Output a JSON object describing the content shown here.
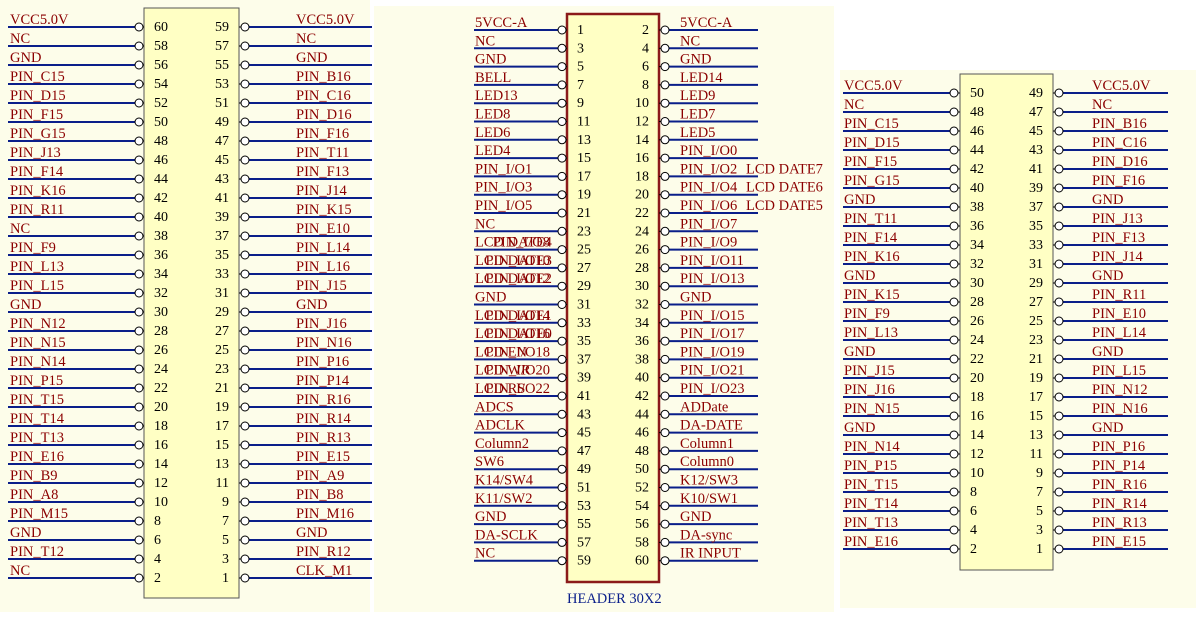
{
  "colors": {
    "panel": "#fdfdea",
    "body_fill": "#ffffc4",
    "body_border": "#555555",
    "wire": "#0a1e8a",
    "net_text": "#8b0000",
    "pin_text": "#000000",
    "ref_text": "#0a1e8a",
    "header_border": "#8b1a1a"
  },
  "connectors": [
    {
      "id": "left",
      "pin_pairs": [
        {
          "l": 60,
          "r": 59,
          "ln": "VCC5.0V",
          "rn": "VCC5.0V"
        },
        {
          "l": 58,
          "r": 57,
          "ln": "NC",
          "rn": "NC"
        },
        {
          "l": 56,
          "r": 55,
          "ln": "GND",
          "rn": "GND"
        },
        {
          "l": 54,
          "r": 53,
          "ln": "PIN_C15",
          "rn": "PIN_B16"
        },
        {
          "l": 52,
          "r": 51,
          "ln": "PIN_D15",
          "rn": "PIN_C16"
        },
        {
          "l": 50,
          "r": 49,
          "ln": "PIN_F15",
          "rn": "PIN_D16"
        },
        {
          "l": 48,
          "r": 47,
          "ln": "PIN_G15",
          "rn": "PIN_F16"
        },
        {
          "l": 46,
          "r": 45,
          "ln": "PIN_J13",
          "rn": "PIN_T11"
        },
        {
          "l": 44,
          "r": 43,
          "ln": "PIN_F14",
          "rn": "PIN_F13"
        },
        {
          "l": 42,
          "r": 41,
          "ln": "PIN_K16",
          "rn": "PIN_J14"
        },
        {
          "l": 40,
          "r": 39,
          "ln": "PIN_R11",
          "rn": "PIN_K15"
        },
        {
          "l": 38,
          "r": 37,
          "ln": "NC",
          "rn": "PIN_E10"
        },
        {
          "l": 36,
          "r": 35,
          "ln": "PIN_F9",
          "rn": "PIN_L14"
        },
        {
          "l": 34,
          "r": 33,
          "ln": "PIN_L13",
          "rn": "PIN_L16"
        },
        {
          "l": 32,
          "r": 31,
          "ln": "PIN_L15",
          "rn": "PIN_J15"
        },
        {
          "l": 30,
          "r": 29,
          "ln": "GND",
          "rn": "GND"
        },
        {
          "l": 28,
          "r": 27,
          "ln": "PIN_N12",
          "rn": "PIN_J16"
        },
        {
          "l": 26,
          "r": 25,
          "ln": "PIN_N15",
          "rn": "PIN_N16"
        },
        {
          "l": 24,
          "r": 23,
          "ln": "PIN_N14",
          "rn": "PIN_P16"
        },
        {
          "l": 22,
          "r": 21,
          "ln": "PIN_P15",
          "rn": "PIN_P14"
        },
        {
          "l": 20,
          "r": 19,
          "ln": "PIN_T15",
          "rn": "PIN_R16"
        },
        {
          "l": 18,
          "r": 17,
          "ln": "PIN_T14",
          "rn": "PIN_R14"
        },
        {
          "l": 16,
          "r": 15,
          "ln": "PIN_T13",
          "rn": "PIN_R13"
        },
        {
          "l": 14,
          "r": 13,
          "ln": "PIN_E16",
          "rn": "PIN_E15"
        },
        {
          "l": 12,
          "r": 11,
          "ln": "PIN_B9",
          "rn": "PIN_A9"
        },
        {
          "l": 10,
          "r": 9,
          "ln": "PIN_A8",
          "rn": "PIN_B8"
        },
        {
          "l": 8,
          "r": 7,
          "ln": "PIN_M15",
          "rn": "PIN_M16"
        },
        {
          "l": 6,
          "r": 5,
          "ln": "GND",
          "rn": "GND"
        },
        {
          "l": 4,
          "r": 3,
          "ln": "PIN_T12",
          "rn": "PIN_R12"
        },
        {
          "l": 2,
          "r": 1,
          "ln": "NC",
          "rn": "CLK_M1"
        }
      ]
    },
    {
      "id": "middle",
      "ref_label": "HEADER 30X2",
      "pin_pairs": [
        {
          "l": 1,
          "r": 2,
          "ln": "5VCC-A",
          "rn": "5VCC-A"
        },
        {
          "l": 3,
          "r": 4,
          "ln": "NC",
          "rn": "NC"
        },
        {
          "l": 5,
          "r": 6,
          "ln": "GND",
          "rn": "GND"
        },
        {
          "l": 7,
          "r": 8,
          "ln": "BELL",
          "rn": "LED14"
        },
        {
          "l": 9,
          "r": 10,
          "ln": "LED13",
          "rn": "LED9"
        },
        {
          "l": 11,
          "r": 12,
          "ln": "LED8",
          "rn": "LED7"
        },
        {
          "l": 13,
          "r": 14,
          "ln": "LED6",
          "rn": "LED5"
        },
        {
          "l": 15,
          "r": 16,
          "ln": "LED4",
          "rn": "PIN_I/O0"
        },
        {
          "l": 17,
          "r": 18,
          "ln": "PIN_I/O1",
          "rn": "PIN_I/O2",
          "rx": "LCD DATE7"
        },
        {
          "l": 19,
          "r": 20,
          "ln": "PIN_I/O3",
          "rn": "PIN_I/O4",
          "rx": "LCD DATE6"
        },
        {
          "l": 21,
          "r": 22,
          "ln": "PIN_I/O5",
          "rn": "PIN_I/O6",
          "rx": "LCD DATE5"
        },
        {
          "l": 23,
          "r": 24,
          "ln": "NC",
          "rn": "PIN_I/O7"
        },
        {
          "l": 25,
          "r": 26,
          "ln": "LCD DATE4",
          "lx": "PIN_I/O8",
          "rn": "PIN_I/O9"
        },
        {
          "l": 27,
          "r": 28,
          "ln": "LCD DATE3",
          "lx": "PIN_I/O10",
          "rn": "PIN_I/O11"
        },
        {
          "l": 29,
          "r": 30,
          "ln": "LCD DATE2",
          "lx": "PIN_I/O12",
          "rn": "PIN_I/O13"
        },
        {
          "l": 31,
          "r": 32,
          "ln": "GND",
          "rn": "GND"
        },
        {
          "l": 33,
          "r": 34,
          "ln": "LCD DATE1",
          "lx": "PIN_I/O14",
          "rn": "PIN_I/O15"
        },
        {
          "l": 35,
          "r": 36,
          "ln": "LCD DATE0",
          "lx": "PIN_I/O16",
          "rn": "PIN_I/O17"
        },
        {
          "l": 37,
          "r": 38,
          "ln": "LCD EN",
          "lx": "PIN_I/O18",
          "rn": "PIN_I/O19"
        },
        {
          "l": 39,
          "r": 40,
          "ln": "LCD WR",
          "lx": "PIN_I/O20",
          "rn": "PIN_I/O21"
        },
        {
          "l": 41,
          "r": 42,
          "ln": "LCD RS",
          "lx": "PIN_I/O22",
          "rn": "PIN_I/O23"
        },
        {
          "l": 43,
          "r": 44,
          "ln": "ADCS",
          "rn": "ADDate"
        },
        {
          "l": 45,
          "r": 46,
          "ln": "ADCLK",
          "rn": "DA-DATE"
        },
        {
          "l": 47,
          "r": 48,
          "ln": "Column2",
          "rn": "Column1"
        },
        {
          "l": 49,
          "r": 50,
          "ln": "SW6",
          "rn": "Column0"
        },
        {
          "l": 51,
          "r": 52,
          "ln": "K14/SW4",
          "rn": "K12/SW3"
        },
        {
          "l": 53,
          "r": 54,
          "ln": "K11/SW2",
          "rn": "K10/SW1"
        },
        {
          "l": 55,
          "r": 56,
          "ln": "GND",
          "rn": "GND"
        },
        {
          "l": 57,
          "r": 58,
          "ln": "DA-SCLK",
          "rn": "DA-sync"
        },
        {
          "l": 59,
          "r": 60,
          "ln": "NC",
          "rn": "IR INPUT"
        }
      ]
    },
    {
      "id": "right",
      "pin_pairs": [
        {
          "l": 50,
          "r": 49,
          "ln": "VCC5.0V",
          "rn": "VCC5.0V"
        },
        {
          "l": 48,
          "r": 47,
          "ln": "NC",
          "rn": "NC"
        },
        {
          "l": 46,
          "r": 45,
          "ln": "PIN_C15",
          "rn": "PIN_B16"
        },
        {
          "l": 44,
          "r": 43,
          "ln": "PIN_D15",
          "rn": "PIN_C16"
        },
        {
          "l": 42,
          "r": 41,
          "ln": "PIN_F15",
          "rn": "PIN_D16"
        },
        {
          "l": 40,
          "r": 39,
          "ln": "PIN_G15",
          "rn": "PIN_F16"
        },
        {
          "l": 38,
          "r": 37,
          "ln": "GND",
          "rn": "GND"
        },
        {
          "l": 36,
          "r": 35,
          "ln": "PIN_T11",
          "rn": "PIN_J13"
        },
        {
          "l": 34,
          "r": 33,
          "ln": "PIN_F14",
          "rn": "PIN_F13"
        },
        {
          "l": 32,
          "r": 31,
          "ln": "PIN_K16",
          "rn": "PIN_J14"
        },
        {
          "l": 30,
          "r": 29,
          "ln": "GND",
          "rn": "GND"
        },
        {
          "l": 28,
          "r": 27,
          "ln": "PIN_K15",
          "rn": "PIN_R11"
        },
        {
          "l": 26,
          "r": 25,
          "ln": "PIN_F9",
          "rn": "PIN_E10"
        },
        {
          "l": 24,
          "r": 23,
          "ln": "PIN_L13",
          "rn": "PIN_L14"
        },
        {
          "l": 22,
          "r": 21,
          "ln": "GND",
          "rn": "GND"
        },
        {
          "l": 20,
          "r": 19,
          "ln": "PIN_J15",
          "rn": "PIN_L15"
        },
        {
          "l": 18,
          "r": 17,
          "ln": "PIN_J16",
          "rn": "PIN_N12"
        },
        {
          "l": 16,
          "r": 15,
          "ln": "PIN_N15",
          "rn": "PIN_N16"
        },
        {
          "l": 14,
          "r": 13,
          "ln": "GND",
          "rn": "GND"
        },
        {
          "l": 12,
          "r": 11,
          "ln": "PIN_N14",
          "rn": "PIN_P16"
        },
        {
          "l": 10,
          "r": 9,
          "ln": "PIN_P15",
          "rn": "PIN_P14"
        },
        {
          "l": 8,
          "r": 7,
          "ln": "PIN_T15",
          "rn": "PIN_R16"
        },
        {
          "l": 6,
          "r": 5,
          "ln": "PIN_T14",
          "rn": "PIN_R14"
        },
        {
          "l": 4,
          "r": 3,
          "ln": "PIN_T13",
          "rn": "PIN_R13"
        },
        {
          "l": 2,
          "r": 1,
          "ln": "PIN_E16",
          "rn": "PIN_E15"
        }
      ]
    }
  ]
}
